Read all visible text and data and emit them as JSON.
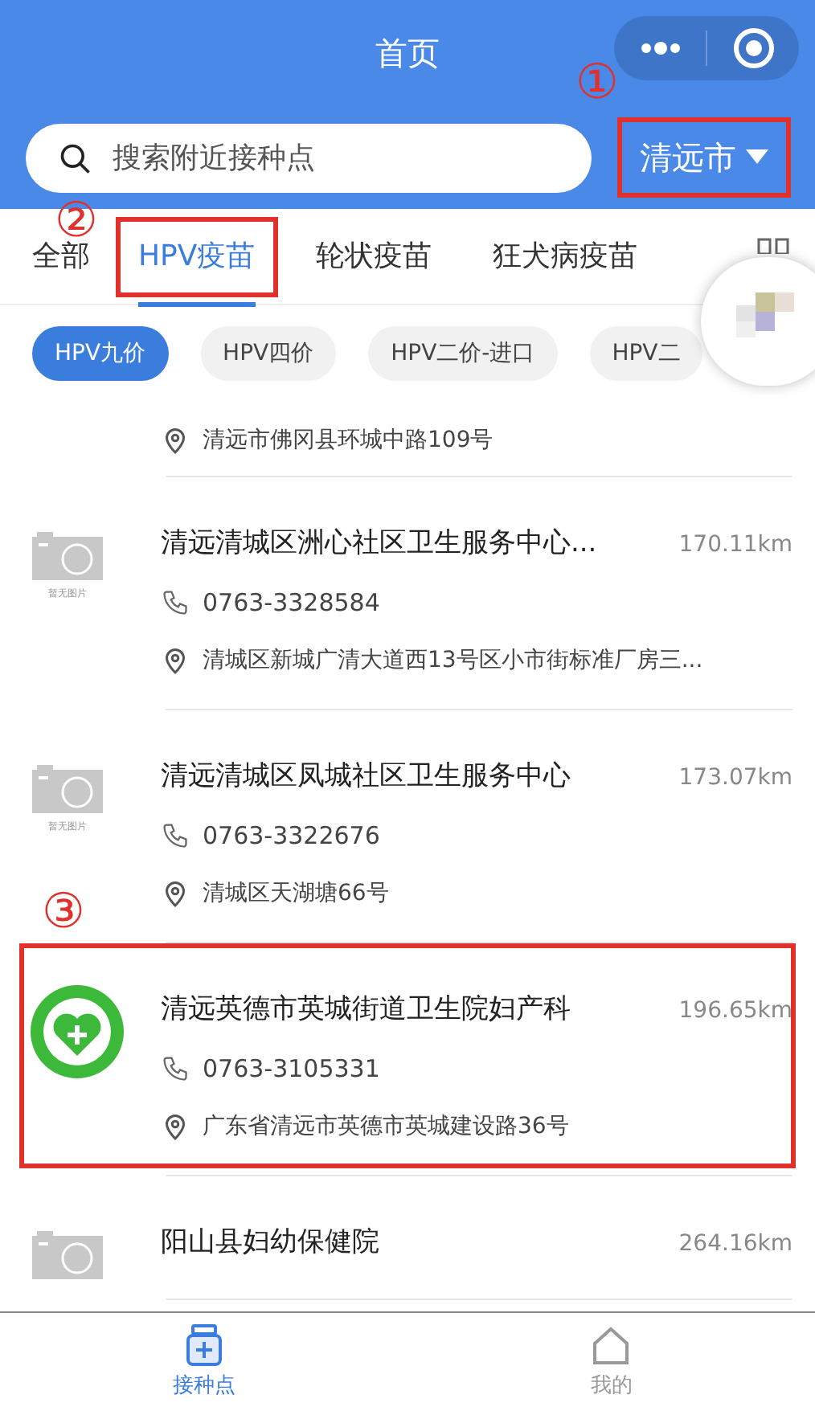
{
  "title_bar": {
    "title": "首页"
  },
  "search": {
    "placeholder": "搜索附近接种点"
  },
  "city_selector": {
    "label": "清远市",
    "highlighted": true,
    "marker": "①"
  },
  "tabs": [
    {
      "label": "全部",
      "selected": false,
      "highlighted": false
    },
    {
      "label": "HPV疫苗",
      "selected": true,
      "highlighted": true,
      "marker": "②"
    },
    {
      "label": "轮状疫苗",
      "selected": false,
      "highlighted": false
    },
    {
      "label": "狂犬病疫苗",
      "selected": false,
      "highlighted": false
    }
  ],
  "chips": [
    {
      "label": "HPV九价",
      "selected": true
    },
    {
      "label": "HPV四价",
      "selected": false
    },
    {
      "label": "HPV二价-进口",
      "selected": false
    },
    {
      "label": "HPV二",
      "selected": false
    }
  ],
  "sites": [
    {
      "kind": "none",
      "address": "清远市佛冈县环城中路109号",
      "highlighted": false
    },
    {
      "kind": "placeholder",
      "image_text": "暂无图片",
      "name": "清远清城区洲心社区卫生服务中心...",
      "distance": "170.11km",
      "phone": "0763-3328584",
      "address": "清城区新城广清大道西13号区小市街标准厂房三...",
      "highlighted": false
    },
    {
      "kind": "placeholder",
      "image_text": "暂无图片",
      "name": "清远清城区凤城社区卫生服务中心",
      "distance": "173.07km",
      "phone": "0763-3322676",
      "address": "清城区天湖塘66号",
      "highlighted": false
    },
    {
      "kind": "logo",
      "name": "清远英德市英城街道卫生院妇产科",
      "distance": "196.65km",
      "phone": "0763-3105331",
      "address": "广东省清远市英德市英城建设路36号",
      "highlighted": true,
      "marker": "③"
    },
    {
      "kind": "placeholder",
      "name": "阳山县妇幼保健院",
      "distance": "264.16km",
      "highlighted": false
    }
  ],
  "bottom_nav": [
    {
      "label": "接种点",
      "selected": true
    },
    {
      "label": "我的",
      "selected": false
    }
  ]
}
